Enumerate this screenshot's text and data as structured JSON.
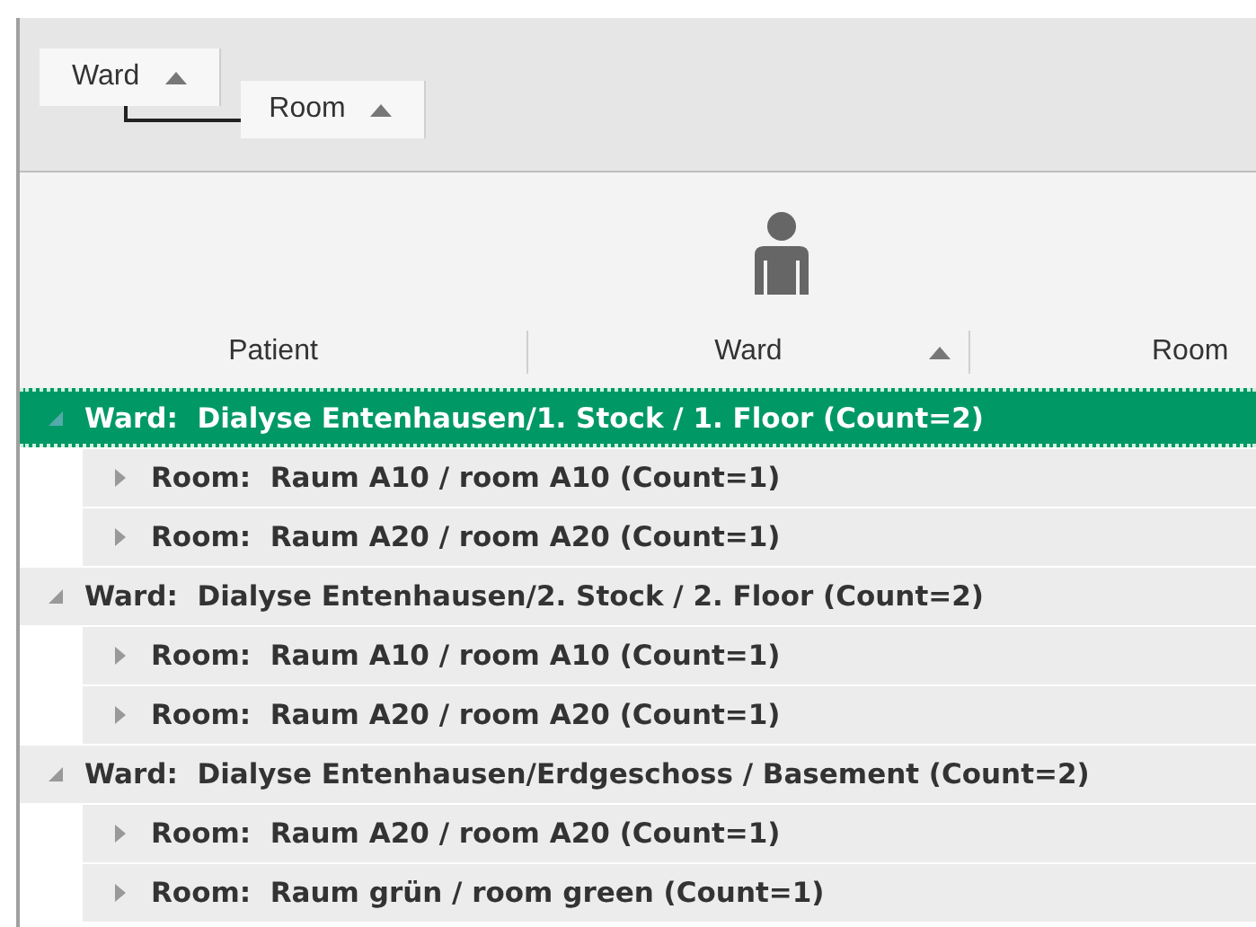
{
  "group_panel": {
    "chips": [
      {
        "label": "Ward",
        "sorted": true
      },
      {
        "label": "Room",
        "sorted": true
      }
    ]
  },
  "columns": [
    {
      "label": "Patient",
      "sorted": false
    },
    {
      "label": "Ward",
      "sorted": true
    },
    {
      "label": "Room",
      "sorted": false
    }
  ],
  "groups": [
    {
      "label": "Ward:  Dialyse Entenhausen/1. Stock / 1. Floor (Count=2)",
      "selected": true,
      "expanded": true,
      "children": [
        {
          "label": "Room:  Raum A10 / room A10 (Count=1)",
          "expanded": false
        },
        {
          "label": "Room:  Raum A20 / room A20 (Count=1)",
          "expanded": false
        }
      ]
    },
    {
      "label": "Ward:  Dialyse Entenhausen/2. Stock / 2. Floor (Count=2)",
      "selected": false,
      "expanded": true,
      "children": [
        {
          "label": "Room:  Raum A10 / room A10 (Count=1)",
          "expanded": false
        },
        {
          "label": "Room:  Raum A20 / room A20 (Count=1)",
          "expanded": false
        }
      ]
    },
    {
      "label": "Ward:  Dialyse Entenhausen/Erdgeschoss / Basement (Count=2)",
      "selected": false,
      "expanded": true,
      "children": [
        {
          "label": "Room:  Raum A20 / room A20 (Count=1)",
          "expanded": false
        },
        {
          "label": "Room:  Raum grün / room green (Count=1)",
          "expanded": false
        }
      ]
    }
  ]
}
